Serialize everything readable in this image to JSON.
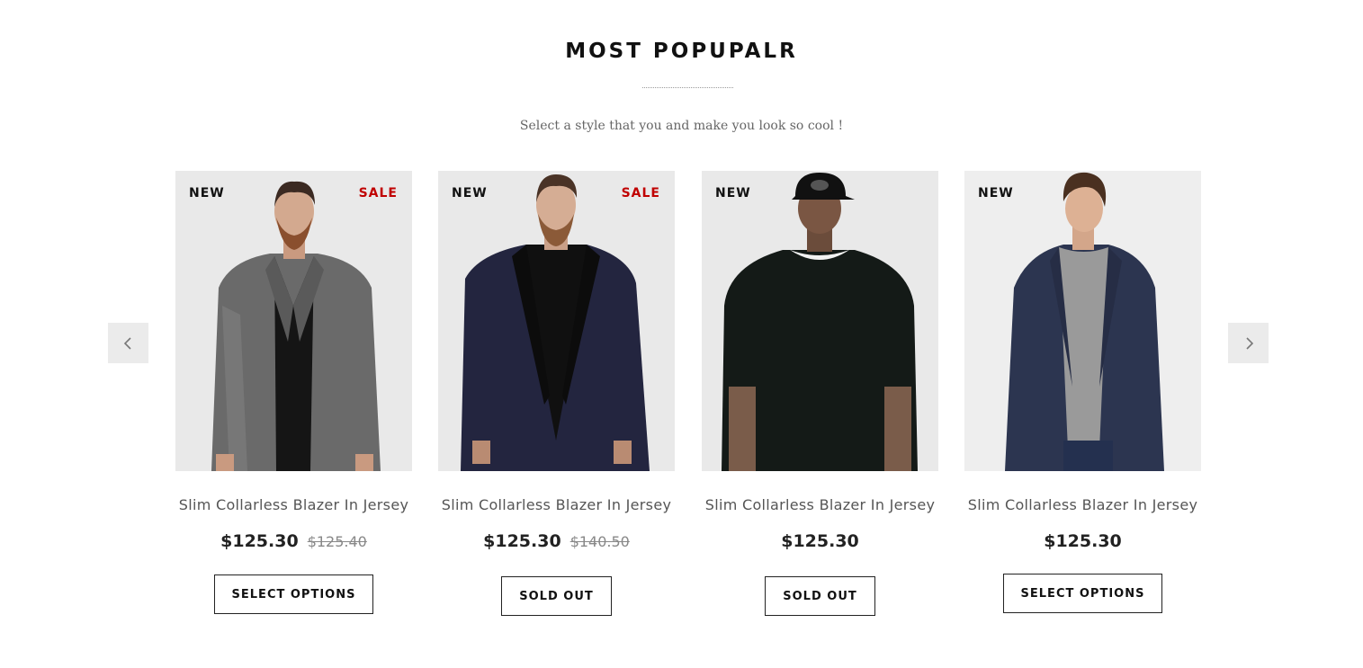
{
  "section": {
    "title": "MOST POPUPALR",
    "subtitle": "Select a style that you and make you look so cool !"
  },
  "carousel": {
    "prev_icon": "chevron-left-icon",
    "next_icon": "chevron-right-icon"
  },
  "products": [
    {
      "badge_new": "NEW",
      "badge_sale": "SALE",
      "name": "Slim Collarless Blazer In Jersey",
      "price": "$125.30",
      "old_price": "$125.40",
      "button_label": "SELECT OPTIONS",
      "outfit": "grey-tweed-blazer"
    },
    {
      "badge_new": "NEW",
      "badge_sale": "SALE",
      "name": "Slim Collarless Blazer In Jersey",
      "price": "$125.30",
      "old_price": "$140.50",
      "button_label": "SOLD OUT",
      "outfit": "navy-shawl-blazer"
    },
    {
      "badge_new": "NEW",
      "badge_sale": "",
      "name": "Slim Collarless Blazer In Jersey",
      "price": "$125.30",
      "old_price": "",
      "button_label": "SOLD OUT",
      "outfit": "black-sweatshirt"
    },
    {
      "badge_new": "NEW",
      "badge_sale": "",
      "name": "Slim Collarless Blazer In Jersey",
      "price": "$125.30",
      "old_price": "",
      "button_label": "SELECT OPTIONS",
      "outfit": "navy-blazer-grey-sweater"
    }
  ],
  "colors": {
    "sale_badge": "#c00000",
    "image_background": "#e9e9e9",
    "arrow_background": "#ebebeb"
  }
}
